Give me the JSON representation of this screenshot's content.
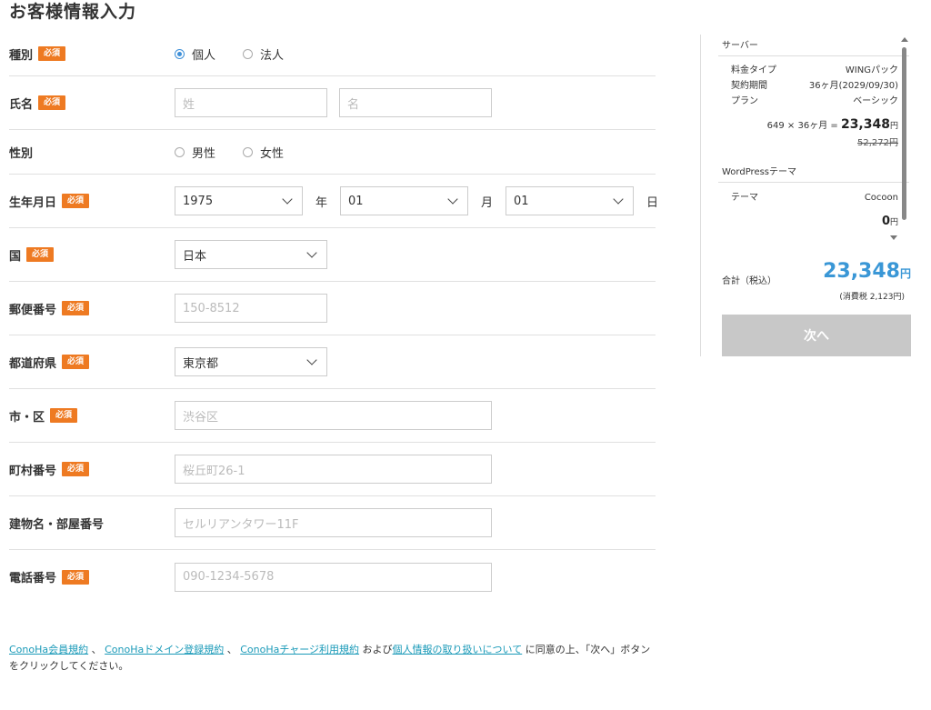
{
  "page_title": "お客様情報入力",
  "required_badge": "必須",
  "form": {
    "type": {
      "label": "種別",
      "options": [
        "個人",
        "法人"
      ],
      "selected": "個人"
    },
    "name": {
      "label": "氏名",
      "last_placeholder": "姓",
      "first_placeholder": "名"
    },
    "gender": {
      "label": "性別",
      "options": [
        "男性",
        "女性"
      ]
    },
    "birthdate": {
      "label": "生年月日",
      "year": "1975",
      "year_unit": "年",
      "month": "01",
      "month_unit": "月",
      "day": "01",
      "day_unit": "日"
    },
    "country": {
      "label": "国",
      "value": "日本"
    },
    "postal": {
      "label": "郵便番号",
      "placeholder": "150-8512"
    },
    "prefecture": {
      "label": "都道府県",
      "value": "東京都"
    },
    "city": {
      "label": "市・区",
      "placeholder": "渋谷区"
    },
    "town": {
      "label": "町村番号",
      "placeholder": "桜丘町26-1"
    },
    "building": {
      "label": "建物名・部屋番号",
      "placeholder": "セルリアンタワー11F"
    },
    "phone": {
      "label": "電話番号",
      "placeholder": "090-1234-5678"
    }
  },
  "terms": {
    "link1": "ConoHa会員規約",
    "sep1": " 、 ",
    "link2": "ConoHaドメイン登録規約",
    "sep2": " 、 ",
    "link3": "ConoHaチャージ利用規約",
    "sep3": " および",
    "link4": "個人情報の取り扱いについて",
    "tail": " に同意の上、「次へ」ボタンをクリックしてください。"
  },
  "sidebar": {
    "server": {
      "title": "サーバー",
      "rows": [
        {
          "key": "料金タイプ",
          "value": "WINGパック"
        },
        {
          "key": "契約期間",
          "value": "36ヶ月(2029/09/30)"
        },
        {
          "key": "プラン",
          "value": "ベーシック"
        }
      ],
      "calc_prefix": "649 × 36ヶ月 = ",
      "calc_amount": "23,348",
      "calc_unit": "円",
      "original_price": "52,272円"
    },
    "wordpress": {
      "title": "WordPressテーマ",
      "rows": [
        {
          "key": "テーマ",
          "value": "Cocoon"
        }
      ],
      "amount": "0",
      "unit": "円"
    },
    "total_label": "合計（税込）",
    "total_amount": "23,348",
    "total_unit": "円",
    "tax_note": "(消費税 2,123円)",
    "next_button": "次へ"
  },
  "colors": {
    "badge": "#ee7a22",
    "link": "#1a9ab8",
    "total": "#3a97d6",
    "radio_selected": "#3d8fd8",
    "disabled_button": "#c8c8c8"
  }
}
